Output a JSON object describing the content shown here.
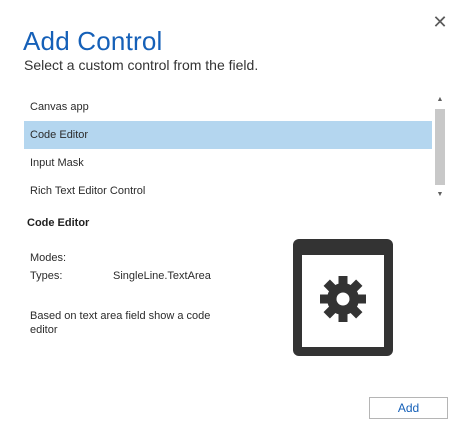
{
  "dialog": {
    "close_glyph": "✕",
    "title": "Add Control",
    "subtitle": "Select a custom control from the field."
  },
  "controls_list": {
    "items": [
      {
        "label": "Canvas app",
        "selected": false
      },
      {
        "label": "Code Editor",
        "selected": true
      },
      {
        "label": "Input Mask",
        "selected": false
      },
      {
        "label": "Rich Text Editor Control",
        "selected": false
      }
    ],
    "scroll_up_glyph": "▲",
    "scroll_down_glyph": "▼"
  },
  "details": {
    "name": "Code Editor",
    "modes_label": "Modes:",
    "modes_value": "",
    "types_label": "Types:",
    "types_value": "SingleLine.TextArea",
    "description": "Based on text area field show a code editor",
    "preview_icon": "gear-window-icon"
  },
  "footer": {
    "add_label": "Add"
  },
  "colors": {
    "title_blue": "#1560b8",
    "selection": "#b4d6ef",
    "icon_dark": "#333333"
  }
}
